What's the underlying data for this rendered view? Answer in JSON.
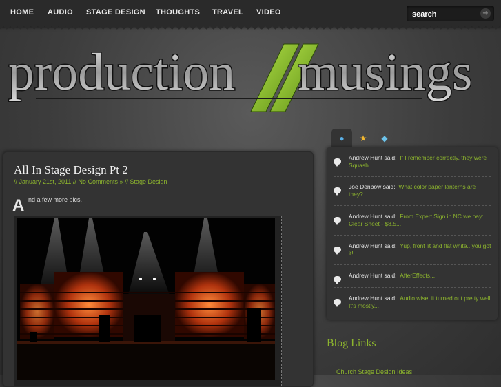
{
  "nav": {
    "items": [
      "HOME",
      "AUDIO",
      "STAGE DESIGN",
      "THOUGHTS",
      "TRAVEL",
      "VIDEO"
    ],
    "search_placeholder": "search"
  },
  "logo": {
    "text_left": "production",
    "text_right": "musings",
    "accent_color": "#8cc63f"
  },
  "post": {
    "title": "All In Stage Design Pt 2",
    "meta": {
      "date": "January 21st, 2011",
      "comments": "No Comments »",
      "category": "Stage Design"
    },
    "dropcap": "A",
    "intro": "nd a few more pics."
  },
  "sidebar": {
    "tabs": [
      {
        "icon": "comments-icon"
      },
      {
        "icon": "star-icon"
      },
      {
        "icon": "tag-icon"
      }
    ],
    "comments": [
      {
        "author": "Andrew Hunt said:",
        "excerpt": "If I remember correctly, they were Squash..."
      },
      {
        "author": "Joe Denbow said:",
        "excerpt": "What color paper lanterns are they?..."
      },
      {
        "author": "Andrew Hunt said:",
        "excerpt": "From Expert Sign in NC we pay: Clear Sheet - $8.5..."
      },
      {
        "author": "Andrew Hunt said:",
        "excerpt": "Yup, front lit and flat white...you got it!..."
      },
      {
        "author": "Andrew Hunt said:",
        "excerpt": "AfterEffects..."
      },
      {
        "author": "Andrew Hunt said:",
        "excerpt": "Audio wise, it turned out pretty well. It's mostly..."
      }
    ],
    "blog_links_title": "Blog Links",
    "blog_links": [
      "Church Stage Design Ideas"
    ]
  },
  "colors": {
    "accent": "#8db52e",
    "background": "#454545",
    "panel": "#333333"
  }
}
